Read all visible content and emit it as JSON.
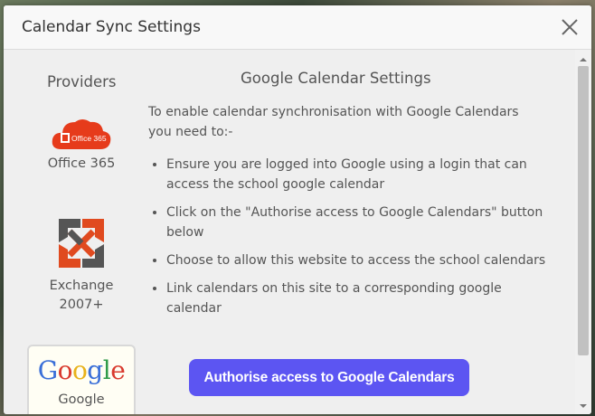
{
  "dialog": {
    "title": "Calendar Sync Settings",
    "close_icon": "close-icon"
  },
  "providers": {
    "heading": "Providers",
    "items": [
      {
        "label_line1": "Office 365",
        "icon": "office365-logo",
        "logo_text": "Office 365"
      },
      {
        "label_line1": "Exchange",
        "label_line2": "2007+",
        "icon": "exchange-logo"
      },
      {
        "label_line1": "Google",
        "icon": "google-logo",
        "logo_text": "Google",
        "selected": true
      }
    ]
  },
  "settings": {
    "heading": "Google Calendar Settings",
    "intro": "To enable calendar synchronisation with Google Calendars you need to:-",
    "steps": [
      "Ensure you are logged into Google using a login that can access the school google calendar",
      "Click on the \"Authorise access to Google Calendars\" button below",
      "Choose to allow this website to access the school calendars",
      "Link calendars on this site to a corresponding google calendar"
    ],
    "button_label": "Authorise access to Google Calendars"
  },
  "colors": {
    "accent_button": "#5c55f2",
    "office_red": "#e63b1b",
    "exchange_orange": "#e04a1f"
  }
}
